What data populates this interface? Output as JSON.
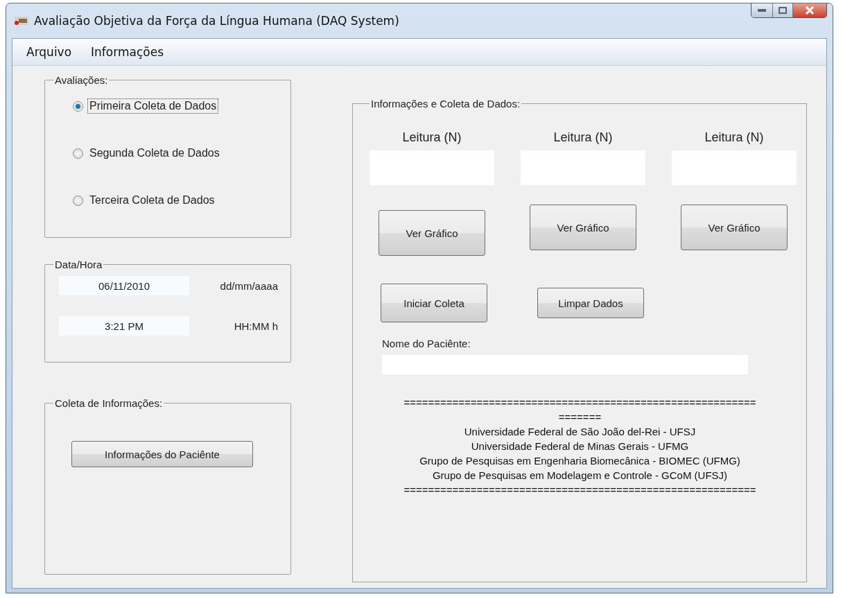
{
  "window": {
    "title": "Avaliação Objetiva da Força da Língua Humana (DAQ System)"
  },
  "menu": [
    "Arquivo",
    "Informações"
  ],
  "evaluations": {
    "title": "Avaliações:",
    "options": [
      {
        "label": "Primeira Coleta de Dados",
        "selected": true
      },
      {
        "label": "Segunda Coleta de Dados",
        "selected": false
      },
      {
        "label": "Terceira Coleta de Dados",
        "selected": false
      }
    ]
  },
  "datetime": {
    "title": "Data/Hora",
    "rows": [
      {
        "value": "06/11/2010",
        "format": "dd/mm/aaaa"
      },
      {
        "value": "3:21 PM",
        "format": "HH:MM h"
      }
    ]
  },
  "info_collect": {
    "title": "Coleta de Informações:",
    "button": "Informações do Paciênte"
  },
  "data_panel": {
    "title": "Informações e Coleta de Dados:",
    "readings": [
      {
        "label": "Leitura (N)",
        "button": "Ver Gráfico"
      },
      {
        "label": "Leitura (N)",
        "button": "Ver Gráfico"
      },
      {
        "label": "Leitura (N)",
        "button": "Ver Gráfico"
      }
    ],
    "actions": [
      "Iniciar Coleta",
      "Limpar Dados"
    ],
    "patient_label": "Nome do Paciênte:",
    "footer": [
      "==========================================================",
      "=======",
      "Universidade Federal de São João del-Rei - UFSJ",
      "Universidade Federal de Minas Gerais - UFMG",
      "Grupo de Pesquisas em Engenharia Biomecânica - BIOMEC (UFMG)",
      "Grupo de Pesquisas em Modelagem e Controle - GCoM (UFSJ)",
      "=========================================================="
    ]
  }
}
